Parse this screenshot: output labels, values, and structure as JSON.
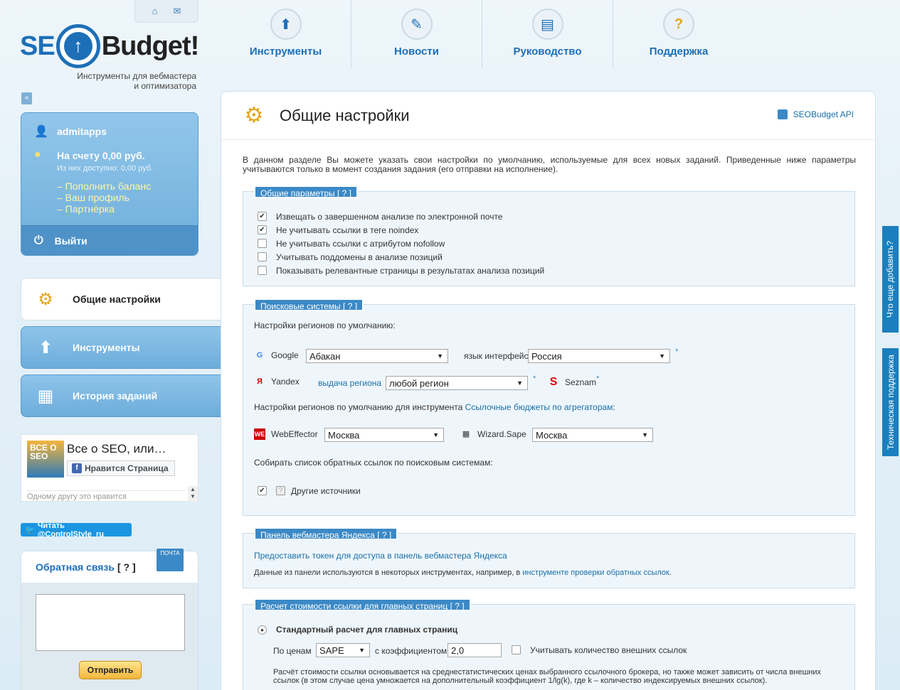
{
  "header": {
    "logo_seo": "SE",
    "logo_budget": "Budget!",
    "tagline": "Инструменты для вебмастера и оптимизатора",
    "nav": [
      {
        "label": "Инструменты",
        "icon": "tools-icon",
        "glyph": "⬆"
      },
      {
        "label": "Новости",
        "icon": "pencil-icon",
        "glyph": "✎"
      },
      {
        "label": "Руководство",
        "icon": "book-icon",
        "glyph": "▤"
      },
      {
        "label": "Поддержка",
        "icon": "question-icon",
        "glyph": "?"
      }
    ]
  },
  "sidebar": {
    "collapse": "«",
    "username": "admitapps",
    "balance": "На счету 0,00 руб.",
    "available": "Из них доступно: 0,00 руб.",
    "links": [
      "– Пополнить баланс",
      "– Ваш профиль",
      "– Партнёрка"
    ],
    "logout": "Выйти",
    "menu": [
      {
        "label": "Общие настройки",
        "active": true
      },
      {
        "label": "Инструменты",
        "active": false
      },
      {
        "label": "История заданий",
        "active": false
      }
    ],
    "fb": {
      "thumb": "ВСЕ О SEO",
      "title": "Все о SEO, или…",
      "like": "Нравится Страница",
      "friends": "Одному другу это нравится"
    },
    "twitter": "Читать @ControlStyle_ru",
    "feedback": {
      "title": "Обратная связь",
      "help": "[ ? ]",
      "mail_label": "ПОЧТА",
      "send": "Отправить"
    }
  },
  "main": {
    "title": "Общие настройки",
    "api_link": "SEOBudget API",
    "intro": "В данном разделе Вы можете указать свои настройки по умолчанию, используемые для всех новых заданий. Приведенные ниже параметры учитываются только в момент создания задания (его отправки на исполнение).",
    "general": {
      "legend": "Общие параметры",
      "help": "[ ? ]",
      "options": [
        {
          "label": "Извещать о завершенном анализе по электронной почте",
          "checked": true
        },
        {
          "label": "Не учитывать ссылки в теге noindex",
          "checked": true
        },
        {
          "label": "Не учитывать ссылки с атрибутом nofollow",
          "checked": false
        },
        {
          "label": "Учитывать поддомены в анализе позиций",
          "checked": false
        },
        {
          "label": "Показывать релевантные страницы в результатах анализа позиций",
          "checked": false
        }
      ]
    },
    "search": {
      "legend": "Поисковые системы",
      "help": "[ ? ]",
      "regions_label": "Настройки регионов по умолчанию:",
      "google_label": "Google",
      "google_region": "Абакан",
      "lang_label": "язык интерфейса",
      "lang_value": "Россия",
      "yandex_label": "Yandex",
      "yandex_link": "выдача региона",
      "yandex_region": "любой регион",
      "seznam_label": "Seznam",
      "star": "*",
      "agg_prefix": "Настройки регионов по умолчанию для инструмента ",
      "agg_link": "Ссылочные бюджеты по агрегаторам",
      "agg_suffix": ":",
      "webeffector_label": "WebEffector",
      "webeffector_value": "Москва",
      "wizard_label": "Wizard.Sape",
      "wizard_value": "Москва",
      "backlinks_label": "Собирать список обратных ссылок по поисковым системам:",
      "other_sources": "Другие источники"
    },
    "webmaster": {
      "legend": "Панель вебмастера Яндекса",
      "help": "[ ? ]",
      "token_link": "Предоставить токен для доступа в панель вебмастера Яндекса",
      "text_prefix": "Данные из панели используются в некоторых инструментах, например, в ",
      "text_link": "инструменте проверки обратных ссылок",
      "text_suffix": "."
    },
    "pricing": {
      "legend": "Расчет стоимости ссылки для главных страниц",
      "help": "[ ? ]",
      "standard_label": "Стандартный расчет для главных страниц",
      "by_price": "По ценам",
      "broker": "SAPE",
      "coef_label": "с коэффициентом",
      "coef_value": "2,0",
      "external_label": "Учитывать количество внешних ссылок",
      "note": "Расчёт стоимости ссылки основывается на среднестатистических ценах выбранного ссылочного брокера, но также может зависить от числа внешних ссылок (в этом случае цена умножается на дополнительный коэффициент 1/lg(k), где k – количество индексируемых внешних ссылок)."
    }
  },
  "right_tabs": [
    "Что еще добавить?",
    "Техническая поддержка"
  ],
  "colors": {
    "accent": "#1d6fb8",
    "legend": "#3b89c6",
    "sidebar": "#6eaedb"
  }
}
